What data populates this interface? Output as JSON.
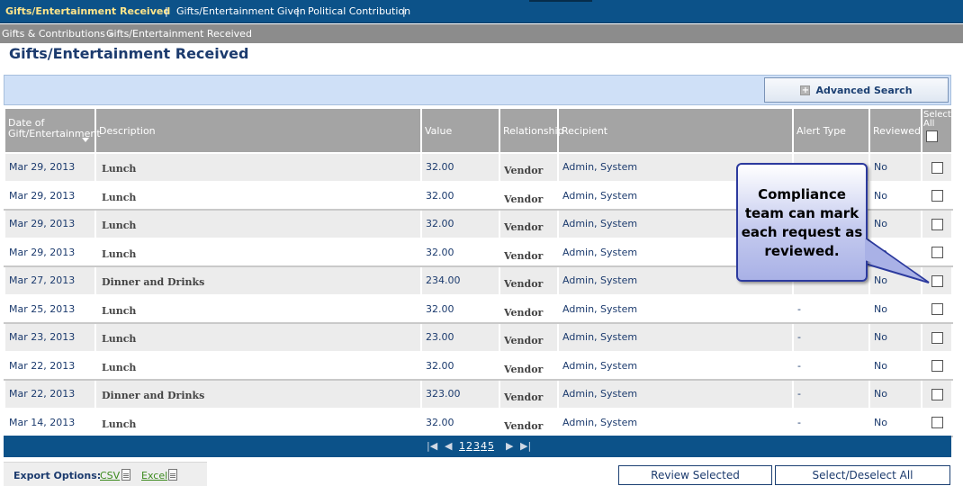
{
  "topnav": {
    "items": [
      "Gifts/Entertainment Received",
      "Gifts/Entertainment Given",
      "Political Contribution"
    ],
    "separator": "|"
  },
  "breadcrumb": {
    "parent": "Gifts & Contributions »",
    "current": "Gifts/Entertainment Received"
  },
  "page_title": "Gifts/Entertainment Received",
  "search": {
    "advanced_label": "Advanced Search",
    "plus_glyph": "+"
  },
  "table": {
    "headers": {
      "date": "Date of Gift/Entertainment",
      "description": "Description",
      "value": "Value",
      "relationship": "Relationship",
      "recipient": "Recipient",
      "alert_type": "Alert Type",
      "reviewed": "Reviewed",
      "select_all": "Select All"
    },
    "rows": [
      {
        "date": "Mar 29, 2013",
        "description": "Lunch",
        "value": "32.00",
        "relationship": "Vendor",
        "recipient": "Admin, System",
        "alert_type": "",
        "reviewed": "No"
      },
      {
        "date": "Mar 29, 2013",
        "description": "Lunch",
        "value": "32.00",
        "relationship": "Vendor",
        "recipient": "Admin, System",
        "alert_type": "",
        "reviewed": "No"
      },
      {
        "date": "Mar 29, 2013",
        "description": "Lunch",
        "value": "32.00",
        "relationship": "Vendor",
        "recipient": "Admin, System",
        "alert_type": "",
        "reviewed": "No"
      },
      {
        "date": "Mar 29, 2013",
        "description": "Lunch",
        "value": "32.00",
        "relationship": "Vendor",
        "recipient": "Admin, System",
        "alert_type": "",
        "reviewed": "No"
      },
      {
        "date": "Mar 27, 2013",
        "description": "Dinner and Drinks",
        "value": "234.00",
        "relationship": "Vendor",
        "recipient": "Admin, System",
        "alert_type": "",
        "reviewed": "No"
      },
      {
        "date": "Mar 25, 2013",
        "description": "Lunch",
        "value": "32.00",
        "relationship": "Vendor",
        "recipient": "Admin, System",
        "alert_type": "-",
        "reviewed": "No"
      },
      {
        "date": "Mar 23, 2013",
        "description": "Lunch",
        "value": "23.00",
        "relationship": "Vendor",
        "recipient": "Admin, System",
        "alert_type": "-",
        "reviewed": "No"
      },
      {
        "date": "Mar 22, 2013",
        "description": "Lunch",
        "value": "32.00",
        "relationship": "Vendor",
        "recipient": "Admin, System",
        "alert_type": "-",
        "reviewed": "No"
      },
      {
        "date": "Mar 22, 2013",
        "description": "Dinner and Drinks",
        "value": "323.00",
        "relationship": "Vendor",
        "recipient": "Admin, System",
        "alert_type": "-",
        "reviewed": "No"
      },
      {
        "date": "Mar 14, 2013",
        "description": "Lunch",
        "value": "32.00",
        "relationship": "Vendor",
        "recipient": "Admin, System",
        "alert_type": "-",
        "reviewed": "No"
      }
    ]
  },
  "pager": {
    "first": "|◀",
    "prev": "◀",
    "next": "▶",
    "last": "▶|",
    "pages": [
      "1",
      "2",
      "3",
      "4",
      "5"
    ]
  },
  "footer": {
    "export_label": "Export Options:",
    "csv": "CSV",
    "excel": "Excel",
    "review_selected": "Review Selected",
    "select_deselect_all": "Select/Deselect All"
  },
  "callout": {
    "text": "Compliance team can mark each request as reviewed."
  }
}
